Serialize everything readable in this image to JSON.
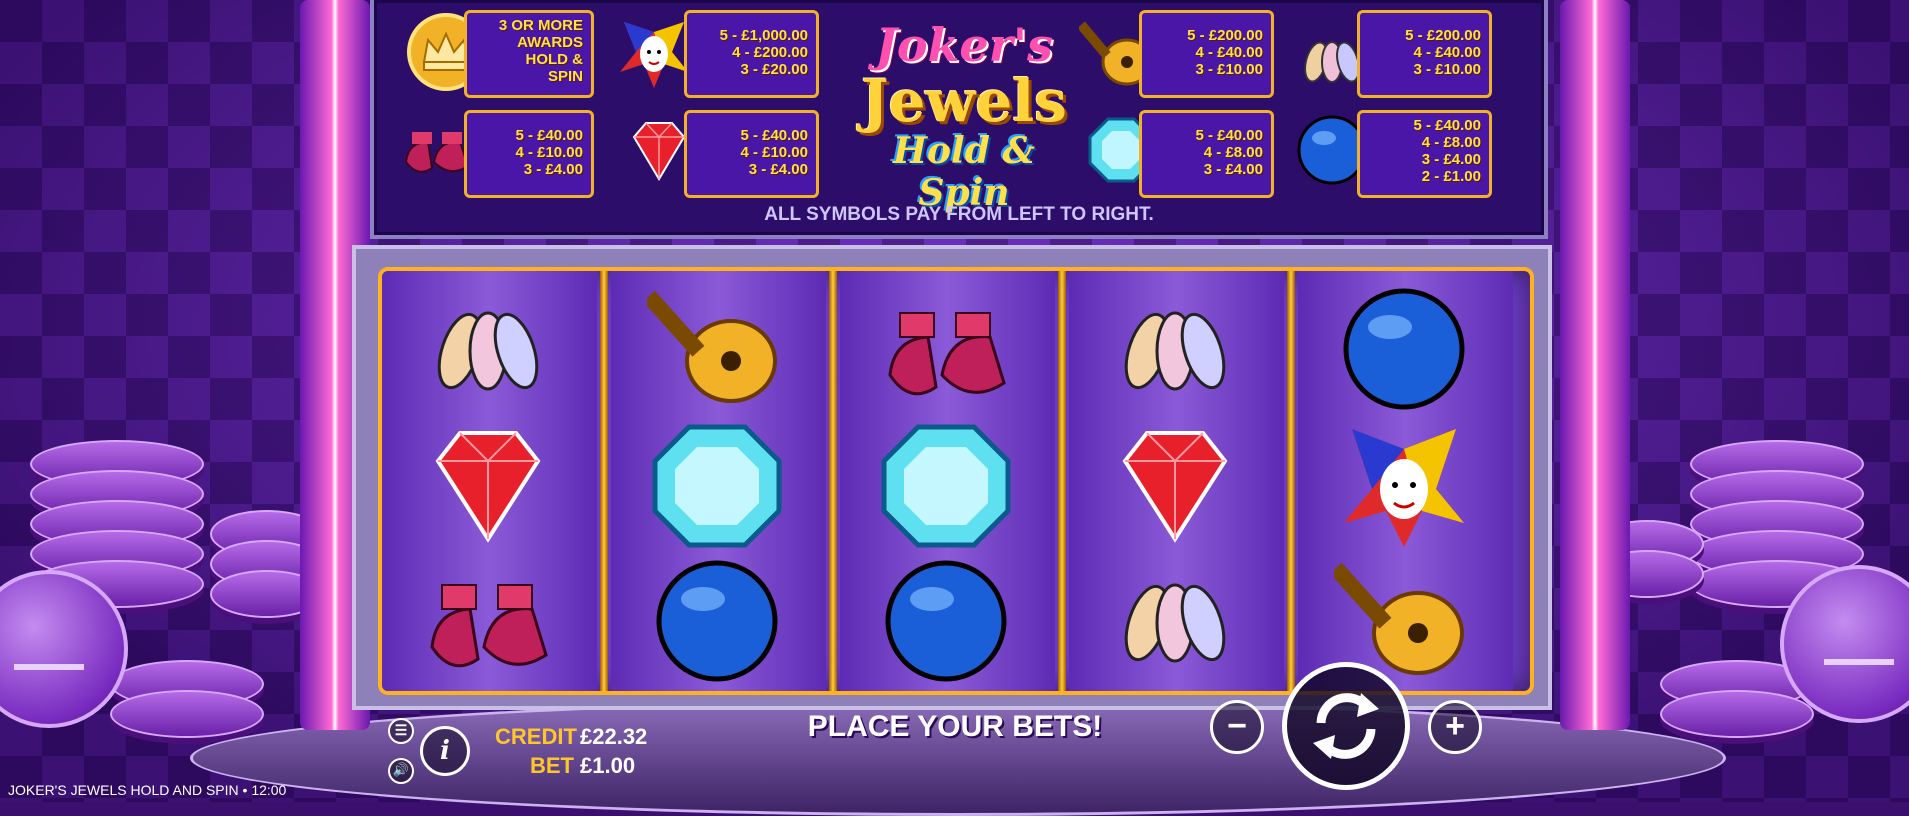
{
  "colors": {
    "accent": "#ffc62a",
    "paytable_bg": "#2d0d6a",
    "box_border": "#f2b227",
    "reel_bg": "#6c3bc4"
  },
  "logo": {
    "line1": "Joker's",
    "line2": "Jewels",
    "line3": "Hold & Spin"
  },
  "paytable": {
    "crown": {
      "icon": "crown-coin-icon",
      "lines": [
        "3 OR MORE",
        "AWARDS",
        "HOLD &",
        "SPIN"
      ]
    },
    "joker": {
      "icon": "joker-icon",
      "lines": [
        "5 - £1,000.00",
        "4 - £200.00",
        "3 - £20.00"
      ]
    },
    "lute": {
      "icon": "lute-icon",
      "lines": [
        "5 - £200.00",
        "4 - £40.00",
        "3 - £10.00"
      ]
    },
    "pins": {
      "icon": "juggling-pins-icon",
      "lines": [
        "5 - £200.00",
        "4 - £40.00",
        "3 - £10.00"
      ]
    },
    "shoes": {
      "icon": "jester-shoes-icon",
      "lines": [
        "5 - £40.00",
        "4 - £10.00",
        "3 - £4.00"
      ]
    },
    "ruby": {
      "icon": "red-gem-icon",
      "lines": [
        "5 - £40.00",
        "4 - £10.00",
        "3 - £4.00"
      ]
    },
    "diamond": {
      "icon": "blue-gem-icon",
      "lines": [
        "5 - £40.00",
        "4 - £8.00",
        "3 - £4.00"
      ]
    },
    "ball": {
      "icon": "blue-ball-icon",
      "lines": [
        "5 - £40.00",
        "4 - £8.00",
        "3 - £4.00",
        "2 - £1.00"
      ]
    },
    "note": "ALL SYMBOLS PAY FROM LEFT TO RIGHT."
  },
  "reels": [
    [
      "juggling-pins",
      "red-gem",
      "jester-shoes"
    ],
    [
      "lute",
      "blue-gem",
      "blue-ball"
    ],
    [
      "jester-shoes",
      "blue-gem",
      "blue-ball"
    ],
    [
      "juggling-pins",
      "red-gem",
      "juggling-pins"
    ],
    [
      "blue-ball",
      "joker",
      "lute"
    ]
  ],
  "controls": {
    "menu_icon": "menu-icon",
    "sound_icon": "sound-icon",
    "info_icon": "info-icon",
    "info_label": "i",
    "credit_label": "CREDIT",
    "credit_value": "£22.32",
    "bet_label": "BET",
    "bet_value": "£1.00",
    "status": "PLACE YOUR BETS!",
    "minus_label": "−",
    "plus_label": "+",
    "spin_icon": "spin-arrows-icon"
  },
  "footer": {
    "game_title": "JOKER'S JEWELS HOLD AND SPIN",
    "separator": "•",
    "time": "12:00"
  }
}
